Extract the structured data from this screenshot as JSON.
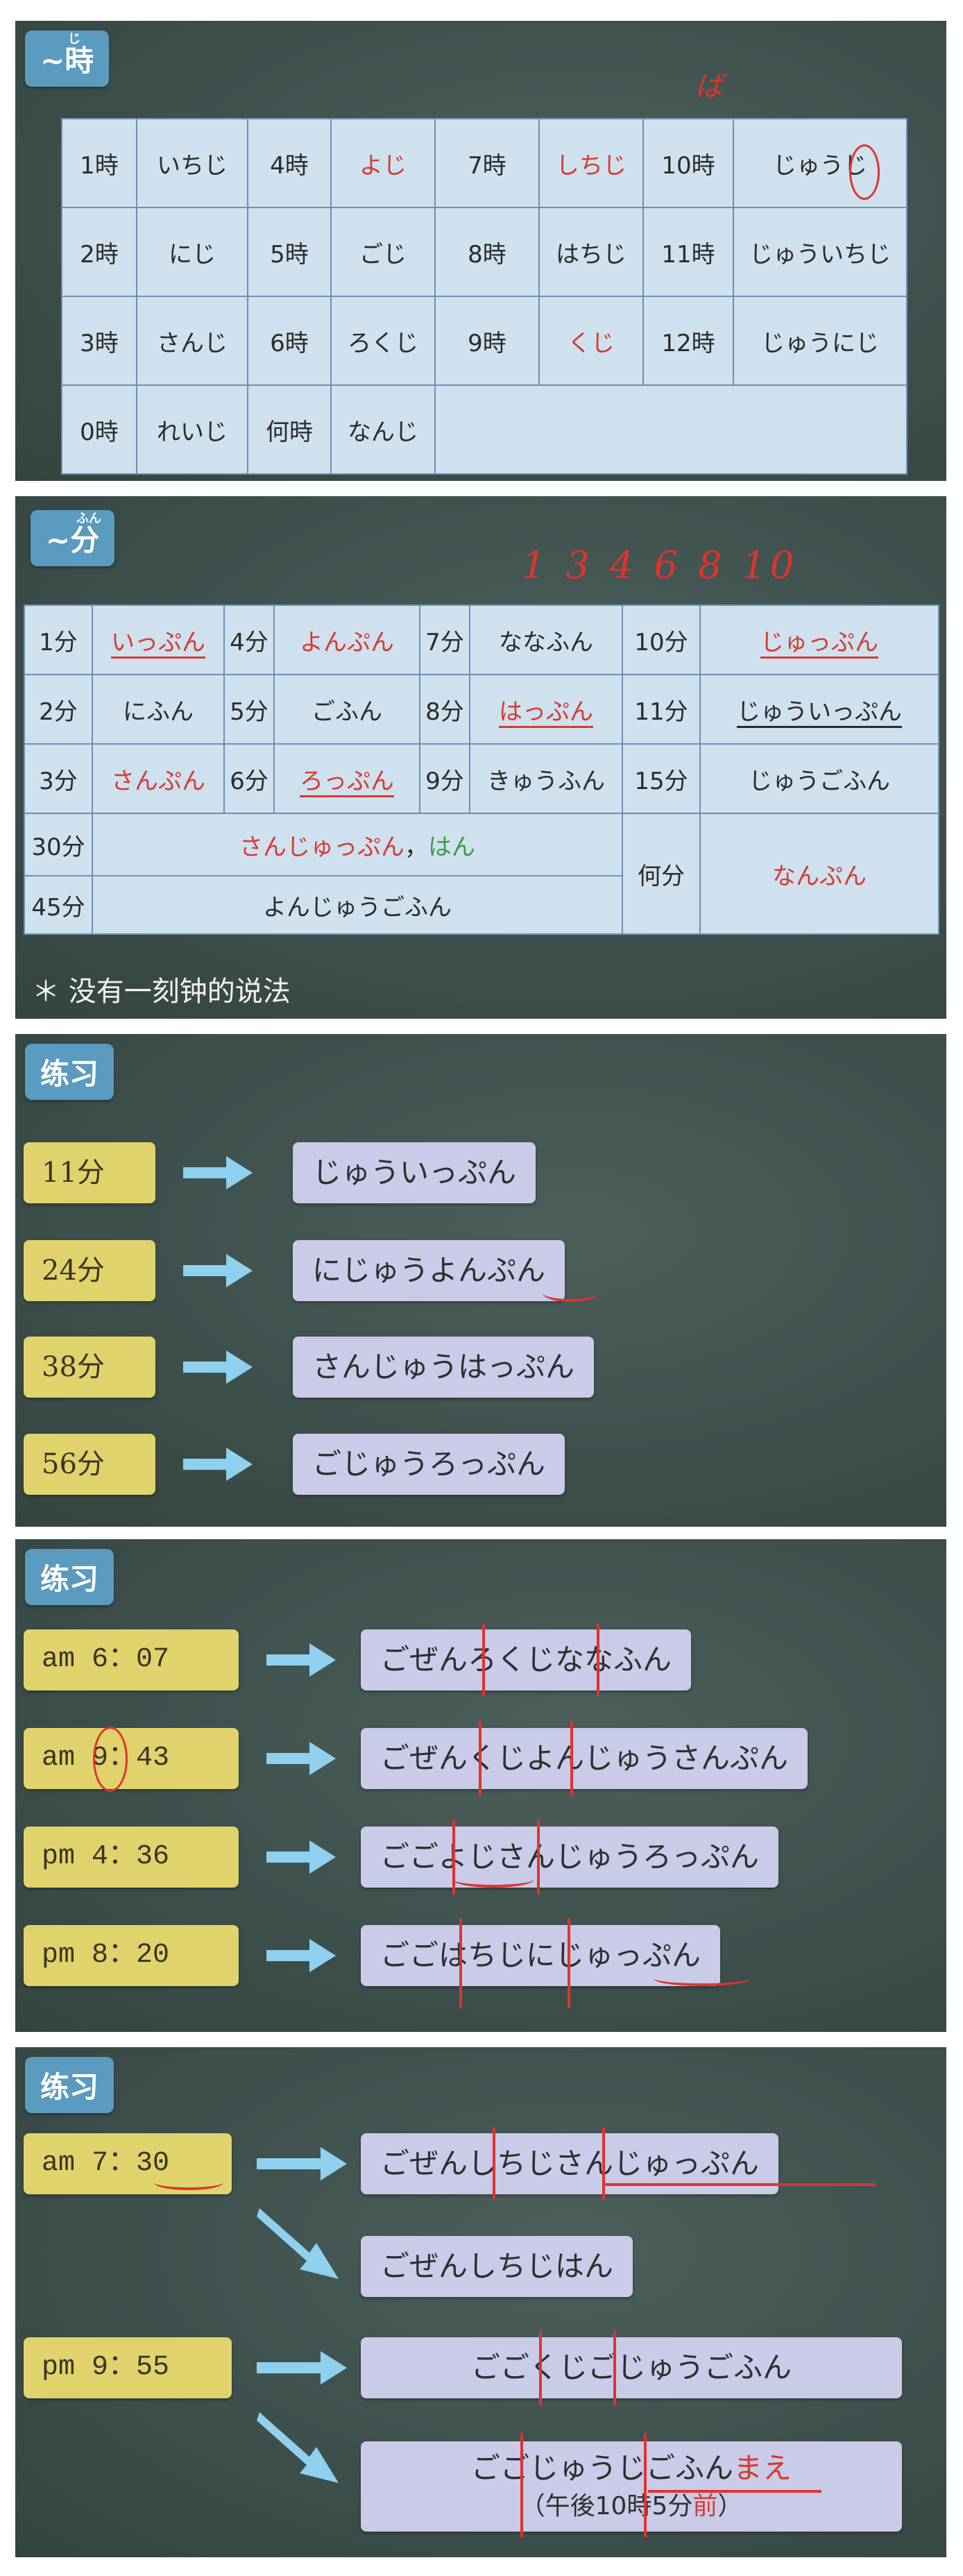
{
  "slide1": {
    "tag": "~時",
    "tag_ruby": "じ",
    "rows": [
      [
        {
          "k": "1時",
          "r": "いちじ",
          "red": false
        },
        {
          "k": "4時",
          "r": "よじ",
          "red": true
        },
        {
          "k": "7時",
          "r": "しちじ",
          "red": true
        },
        {
          "k": "10時",
          "r": "じゅうじ",
          "red": false
        }
      ],
      [
        {
          "k": "2時",
          "r": "にじ",
          "red": false
        },
        {
          "k": "5時",
          "r": "ごじ",
          "red": false
        },
        {
          "k": "8時",
          "r": "はちじ",
          "red": false
        },
        {
          "k": "11時",
          "r": "じゅういちじ",
          "red": false
        }
      ],
      [
        {
          "k": "3時",
          "r": "さんじ",
          "red": false
        },
        {
          "k": "6時",
          "r": "ろくじ",
          "red": false
        },
        {
          "k": "9時",
          "r": "くじ",
          "red": true
        },
        {
          "k": "12時",
          "r": "じゅうにじ",
          "red": false
        }
      ],
      [
        {
          "k": "0時",
          "r": "れいじ",
          "red": false
        },
        {
          "k": "何時",
          "r": "なんじ",
          "red": false
        }
      ]
    ]
  },
  "slide2": {
    "tag": "~分",
    "tag_ruby": "ふん",
    "hand_note": "1 3 4 6 8 10",
    "rows": [
      [
        {
          "k": "1分",
          "r": "いっぷん",
          "style": "red-ul"
        },
        {
          "k": "4分",
          "r": "よんぷん",
          "style": "red"
        },
        {
          "k": "7分",
          "r": "ななふん",
          "style": ""
        },
        {
          "k": "10分",
          "r": "じゅっぷん",
          "style": "red-ul"
        }
      ],
      [
        {
          "k": "2分",
          "r": "にふん",
          "style": ""
        },
        {
          "k": "5分",
          "r": "ごふん",
          "style": ""
        },
        {
          "k": "8分",
          "r": "はっぷん",
          "style": "red-ul"
        },
        {
          "k": "11分",
          "r": "じゅういっぷん",
          "style": "blk-ul"
        }
      ],
      [
        {
          "k": "3分",
          "r": "さんぷん",
          "style": "red"
        },
        {
          "k": "6分",
          "r": "ろっぷん",
          "style": "red-ul"
        },
        {
          "k": "9分",
          "r": "きゅうふん",
          "style": ""
        },
        {
          "k": "15分",
          "r": "じゅうごふん",
          "style": ""
        }
      ]
    ],
    "row30_k": "30分",
    "row30_r": "さんじゅっぷん",
    "row30_sep": "，",
    "row30_han": "はん",
    "row45_k": "45分",
    "row45_r": "よんじゅうごふん",
    "nanpun_k": "何分",
    "nanpun_r": "なんぷん",
    "note": "＊ 没有一刻钟的说法"
  },
  "slide3": {
    "tag": "练习",
    "items": [
      {
        "q": "11分",
        "a": "じゅういっぷん"
      },
      {
        "q": "24分",
        "a": "にじゅうよんぷん"
      },
      {
        "q": "38分",
        "a": "さんじゅうはっぷん"
      },
      {
        "q": "56分",
        "a": "ごじゅうろっぷん"
      }
    ]
  },
  "slide4": {
    "tag": "练习",
    "items": [
      {
        "q": "am 6：07",
        "a": "ごぜんろくじななふん"
      },
      {
        "q": "am 9：43",
        "a": "ごぜんくじよんじゅうさんぷん"
      },
      {
        "q": "pm 4：36",
        "a": "ごごよじさんじゅうろっぷん"
      },
      {
        "q": "pm 8：20",
        "a": "ごごはちじにじゅっぷん"
      }
    ]
  },
  "slide5": {
    "tag": "练习",
    "q1": "am 7：30",
    "a1": "ごぜんしちじさんじゅっぷん",
    "a1b": "ごぜんしちじはん",
    "q2": "pm 9：55",
    "a2": "ごごくじごじゅうごふん",
    "a2b_pre": "ごごじゅうじごふん",
    "a2b_mae": "まえ",
    "a2b_sub_pre": "（午後10時5分",
    "a2b_sub_red": "前",
    "a2b_sub_post": "）"
  }
}
